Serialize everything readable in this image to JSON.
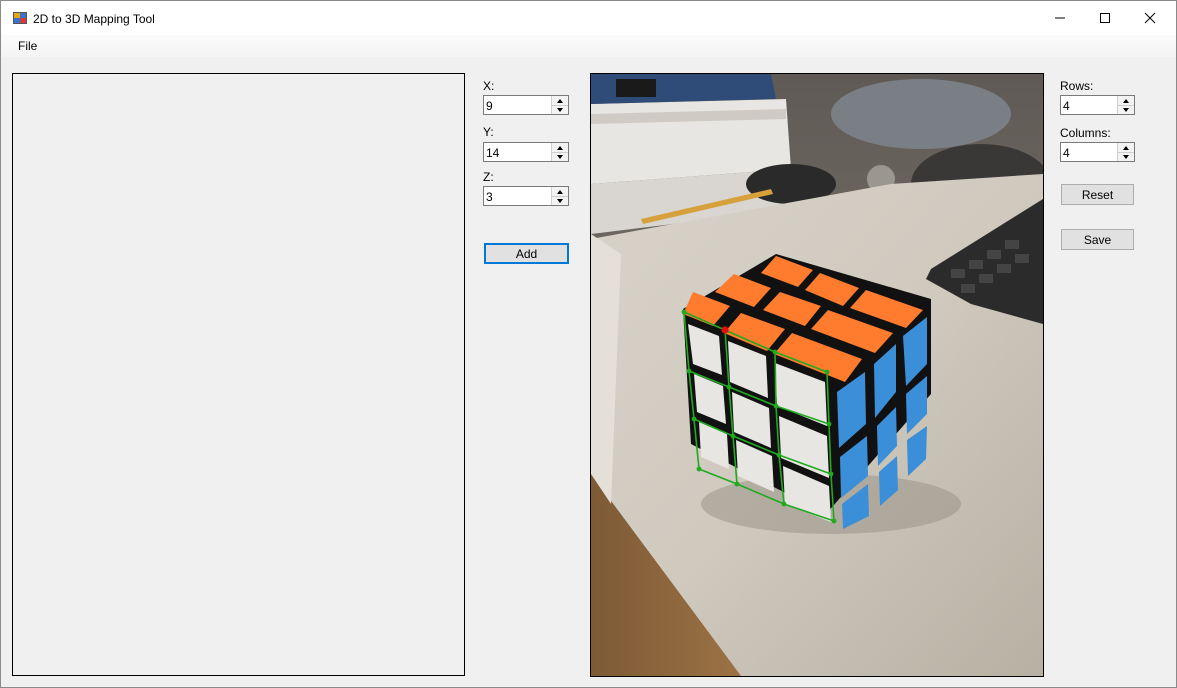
{
  "window": {
    "title": "2D to 3D Mapping Tool"
  },
  "menu": {
    "file_label": "File"
  },
  "point_input": {
    "x_label": "X:",
    "x_value": "9",
    "y_label": "Y:",
    "y_value": "14",
    "z_label": "Z:",
    "z_value": "3",
    "add_label": "Add"
  },
  "grid_settings": {
    "rows_label": "Rows:",
    "rows_value": "4",
    "columns_label": "Columns:",
    "columns_value": "4",
    "reset_label": "Reset",
    "save_label": "Save"
  },
  "icons": {
    "app": "app-icon",
    "minimize": "minimize-icon",
    "maximize": "maximize-icon",
    "close": "close-icon",
    "spin_up": "arrow-up-icon",
    "spin_down": "arrow-down-icon"
  },
  "colors": {
    "grid_overlay": "#1faa1f",
    "selected_point": "#e01010",
    "default_button_border": "#0078d7"
  }
}
